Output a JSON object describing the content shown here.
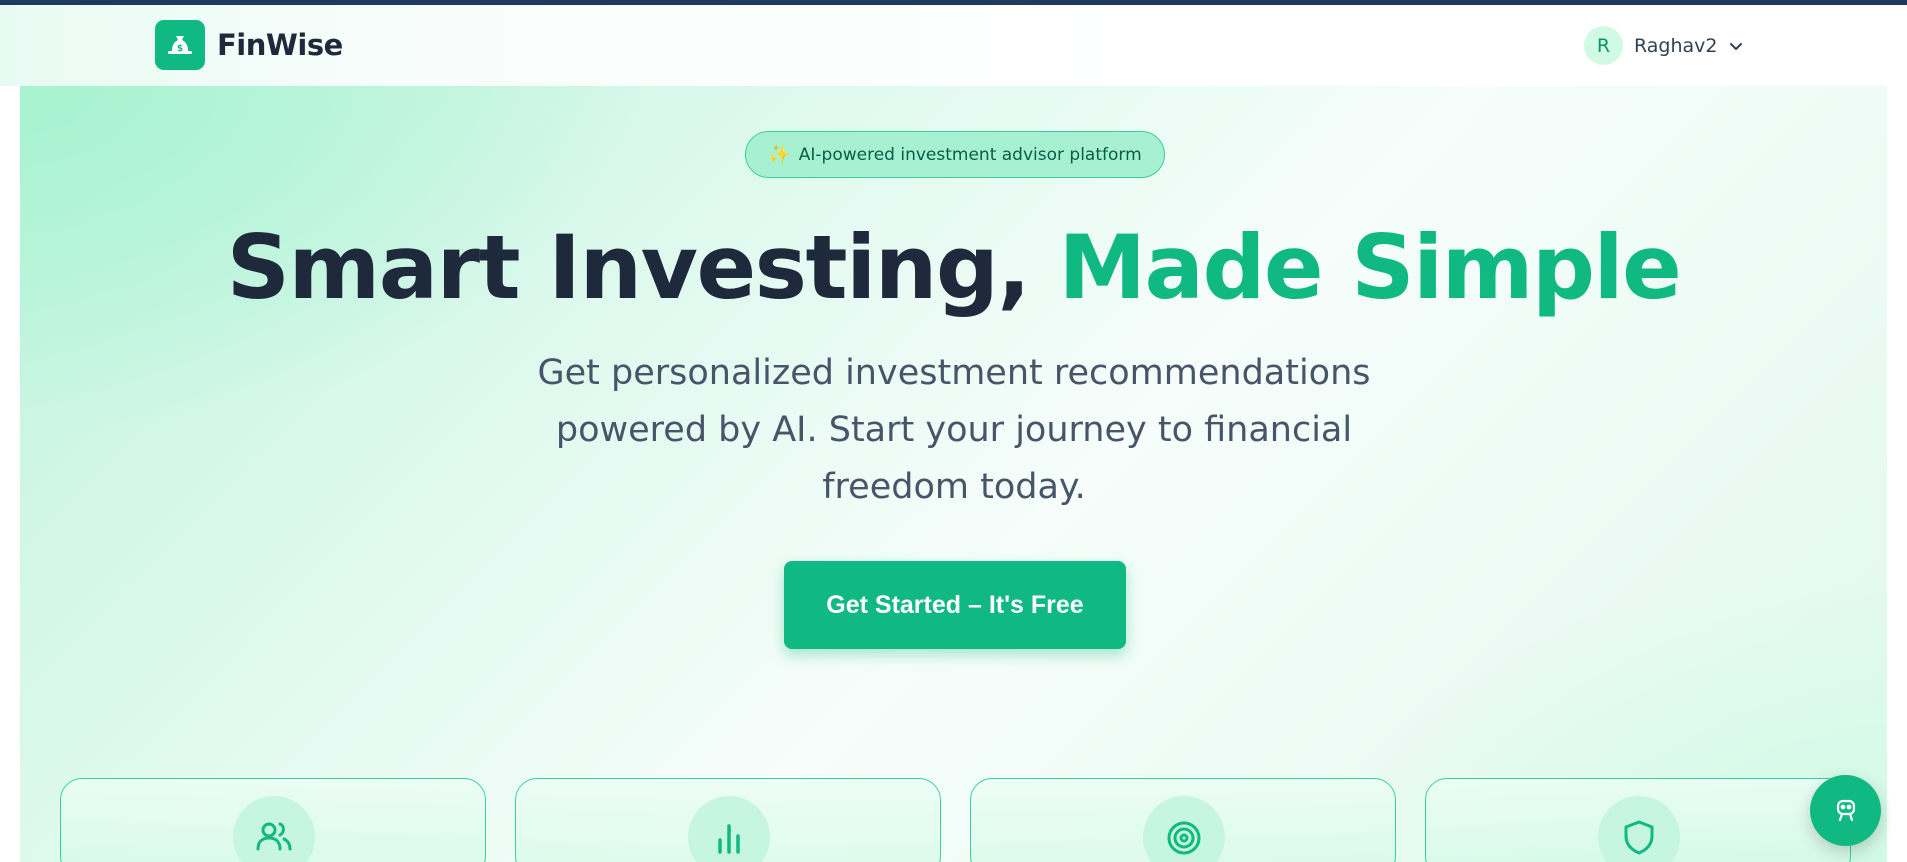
{
  "brand": {
    "name": "FinWise",
    "logo_icon": "money-bag-icon",
    "accent_color": "#10b981"
  },
  "user": {
    "avatar_initial": "R",
    "name": "Raghav2",
    "menu_icon": "chevron-down-icon"
  },
  "hero": {
    "badge_icon": "sparkles-icon",
    "badge_text": "AI-powered investment advisor platform",
    "headline_part1": "Smart Investing, ",
    "headline_part2": "Made Simple",
    "subtext": "Get personalized investment recommendations powered by AI. Start your journey to financial freedom today.",
    "cta_label": "Get Started – It's Free"
  },
  "features": [
    {
      "icon": "users-icon"
    },
    {
      "icon": "bar-chart-icon"
    },
    {
      "icon": "target-icon"
    },
    {
      "icon": "shield-icon"
    }
  ],
  "chat_fab": {
    "icon": "robot-icon"
  }
}
